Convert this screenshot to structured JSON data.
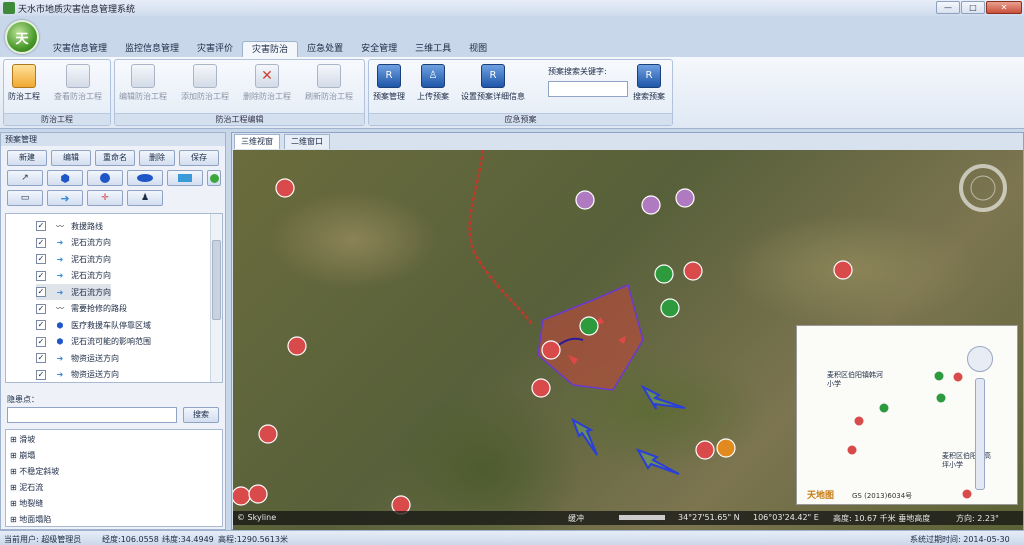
{
  "window": {
    "title": "天水市地质灾害信息管理系统",
    "min_label": "—",
    "max_label": "□",
    "close_label": "✕"
  },
  "logo_text": "天",
  "tabs": [
    "灾害信息管理",
    "监控信息管理",
    "灾害评价",
    "灾害防治",
    "应急处置",
    "安全管理",
    "三维工具",
    "视图"
  ],
  "active_tab": "灾害防治",
  "ribbon": {
    "group1": {
      "label": "防治工程",
      "buttons": [
        "防治工程",
        "查看防治工程"
      ]
    },
    "group2": {
      "label": "防治工程编辑",
      "buttons": [
        "编辑防治工程",
        "添加防治工程",
        "删除防治工程",
        "刷新防治工程"
      ]
    },
    "group3": {
      "label": "应急预案",
      "buttons": [
        "预案管理",
        "上传预案",
        "设置预案详细信息",
        "搜索预案"
      ],
      "search_label": "预案搜索关键字:",
      "search_value": ""
    }
  },
  "left_panel": {
    "title": "预案管理",
    "buttons": [
      "新建",
      "编辑",
      "重命名",
      "删除",
      "保存"
    ],
    "tree_items": [
      {
        "label": "救援路线",
        "checked": true,
        "icon": "route-icon"
      },
      {
        "label": "泥石流方向",
        "checked": true,
        "icon": "arrow-icon"
      },
      {
        "label": "泥石流方向",
        "checked": true,
        "icon": "arrow-icon"
      },
      {
        "label": "泥石流方向",
        "checked": true,
        "icon": "arrow-icon"
      },
      {
        "label": "泥石流方向",
        "checked": true,
        "icon": "arrow-icon"
      },
      {
        "label": "需要抢修的路段",
        "checked": true,
        "icon": "route-icon"
      },
      {
        "label": "医疗救援车队停靠区域",
        "checked": true,
        "icon": "polygon-icon"
      },
      {
        "label": "泥石流可能的影响范围",
        "checked": true,
        "icon": "polygon-icon"
      },
      {
        "label": "物资运送方向",
        "checked": true,
        "icon": "arrow-icon"
      },
      {
        "label": "物资运送方向",
        "checked": true,
        "icon": "arrow-icon"
      }
    ],
    "hazard_label": "隐患点：",
    "hazard_search_value": "",
    "search_button": "搜索",
    "categories": [
      "滑坡",
      "崩塌",
      "不稳定斜坡",
      "泥石流",
      "地裂缝",
      "地面塌陷"
    ]
  },
  "view_tabs": [
    "三维视窗",
    "二维窗口"
  ],
  "active_view": "三维视窗",
  "minimap": {
    "labels": [
      "麦积区伯阳镇韩河小学",
      "麦积区伯阳镇高坪小学"
    ],
    "logo_text": "天地图",
    "copyright": "GS (2013)6034号"
  },
  "map_status": {
    "skyline": "© Skyline",
    "buffer": "缓冲",
    "lat": "34°27'51.65\" N",
    "lon": "106°03'24.42\" E",
    "alt": "高度: 10.67 千米 垂地高度",
    "heading": "方向: 2.23°"
  },
  "status": {
    "user": "当前用户: 超级管理员",
    "lon": "经度:106.0558",
    "lat": "纬度:34.4949",
    "elev": "高程:1290.5613米",
    "expire": "系统过期时间: 2014-05-30"
  },
  "colors": {
    "hazard_red": "#d94b4b",
    "debris_green": "#2e9a3e",
    "collapse_purple": "#b07ac0",
    "blue_arrow": "#2a3fd8"
  }
}
